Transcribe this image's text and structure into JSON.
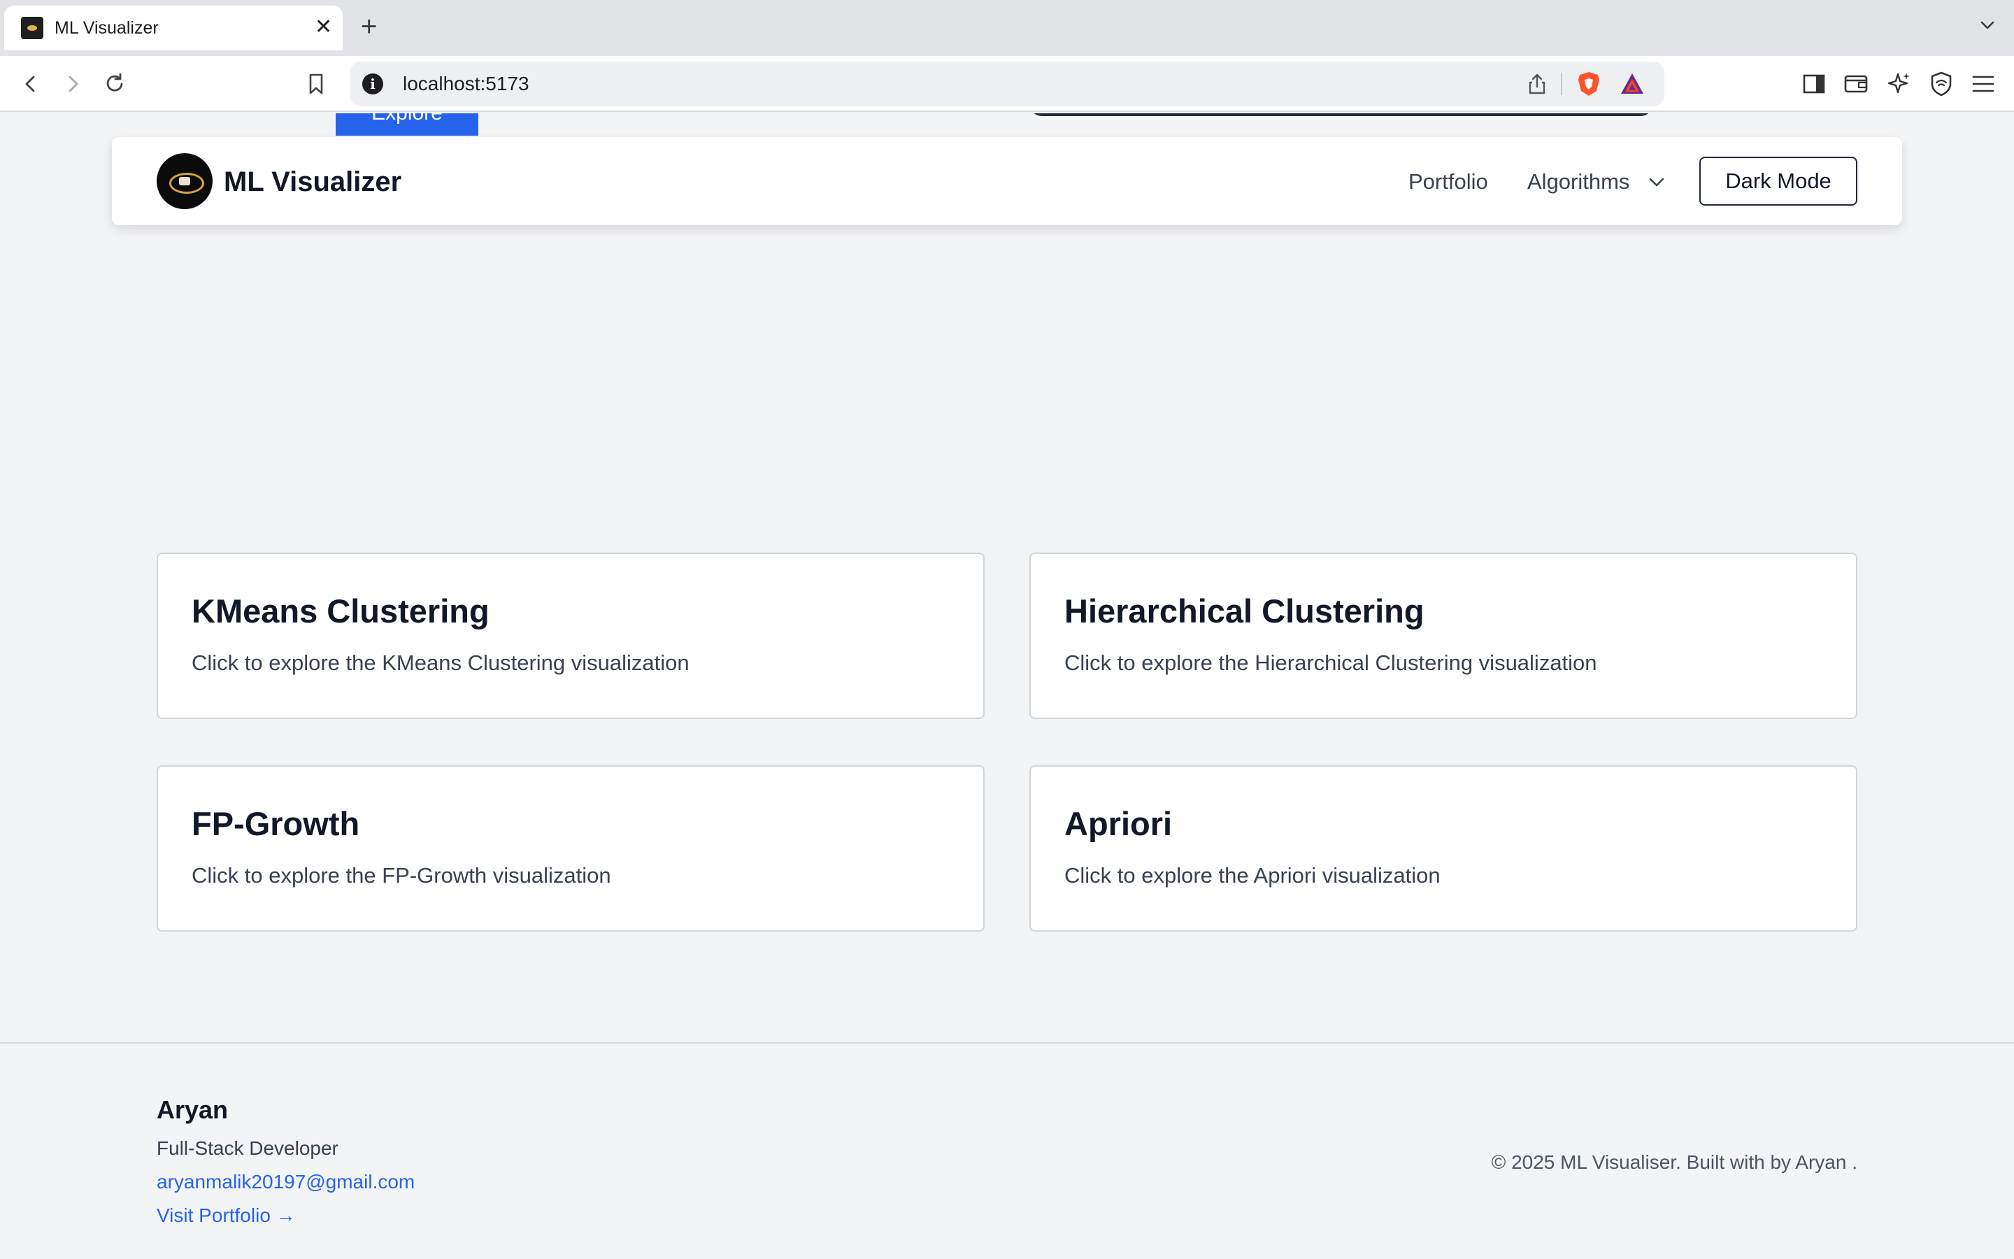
{
  "browser": {
    "tab_title": "ML Visualizer",
    "tab_close": "✕",
    "new_tab": "+",
    "url": "localhost:5173",
    "icons": [
      "back-icon",
      "forward-icon",
      "reload-icon",
      "bookmark-icon",
      "site-info-icon",
      "share-icon",
      "brave-shield-icon",
      "brave-rewards-icon",
      "sidebar-icon",
      "wallet-icon",
      "leo-ai-icon",
      "vpn-icon",
      "menu-icon"
    ]
  },
  "peek": {
    "explore_label": "Explore"
  },
  "navbar": {
    "brand": "ML Visualizer",
    "portfolio": "Portfolio",
    "algorithms": "Algorithms",
    "dark_mode": "Dark Mode"
  },
  "cards": [
    {
      "title": "KMeans Clustering",
      "description": "Click to explore the KMeans Clustering visualization"
    },
    {
      "title": "Hierarchical Clustering",
      "description": "Click to explore the Hierarchical Clustering visualization"
    },
    {
      "title": "FP-Growth",
      "description": "Click to explore the FP-Growth visualization"
    },
    {
      "title": "Apriori",
      "description": "Click to explore the Apriori visualization"
    }
  ],
  "footer": {
    "name": "Aryan",
    "role": "Full-Stack Developer",
    "email": "aryanmalik20197@gmail.com",
    "portfolio_link": "Visit Portfolio →",
    "copyright": "© 2025 ML Visualiser. Built with by Aryan ."
  },
  "colors": {
    "accent": "#2563eb",
    "page_bg": "#f3f4f6",
    "card_border": "#d1d5db",
    "text_dark": "#111827"
  }
}
